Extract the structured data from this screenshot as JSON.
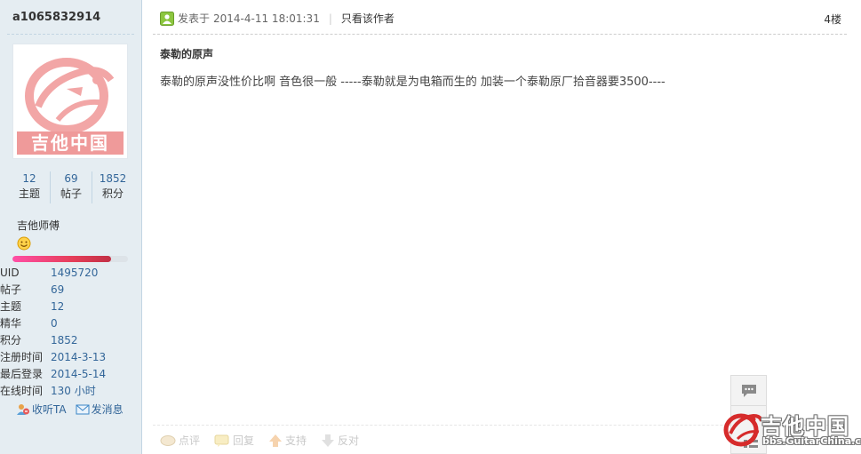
{
  "sidebar": {
    "username": "a1065832914",
    "avatar_text": "吉他中国",
    "stats": [
      {
        "value": "12",
        "label": "主题"
      },
      {
        "value": "69",
        "label": "帖子"
      },
      {
        "value": "1852",
        "label": "积分"
      }
    ],
    "rank": "吉他师傅",
    "rank_icon": "smile-icon",
    "level_progress": 0.85,
    "profile": [
      {
        "key": "UID",
        "value": "1495720"
      },
      {
        "key": "帖子",
        "value": "69"
      },
      {
        "key": "主题",
        "value": "12"
      },
      {
        "key": "精华",
        "value": "0"
      },
      {
        "key": "积分",
        "value": "1852"
      },
      {
        "key": "注册时间",
        "value": "2014-3-13"
      },
      {
        "key": "最后登录",
        "value": "2014-5-14"
      },
      {
        "key": "在线时间",
        "value": "130 小时"
      }
    ],
    "actions": {
      "follow": "收听TA",
      "message": "发消息"
    }
  },
  "post": {
    "posted_label": "发表于",
    "date": "2014-4-11 18:01:31",
    "author_only": "只看该作者",
    "floor": "4楼",
    "title": "泰勒的原声",
    "body": "泰勒的原声没性价比啊 音色很一般  -----泰勒就是为电箱而生的  加装一个泰勒原厂拾音器要3500----"
  },
  "bottom_actions": {
    "comment": "点评",
    "reply": "回复",
    "support": "支持",
    "oppose": "反对"
  },
  "watermark": {
    "title": "吉他中国",
    "url": "bbs.GuitarChina.com"
  },
  "colors": {
    "sidebar_bg": "#e5edf2",
    "link": "#336699",
    "level_bar": "#e63e5a"
  }
}
